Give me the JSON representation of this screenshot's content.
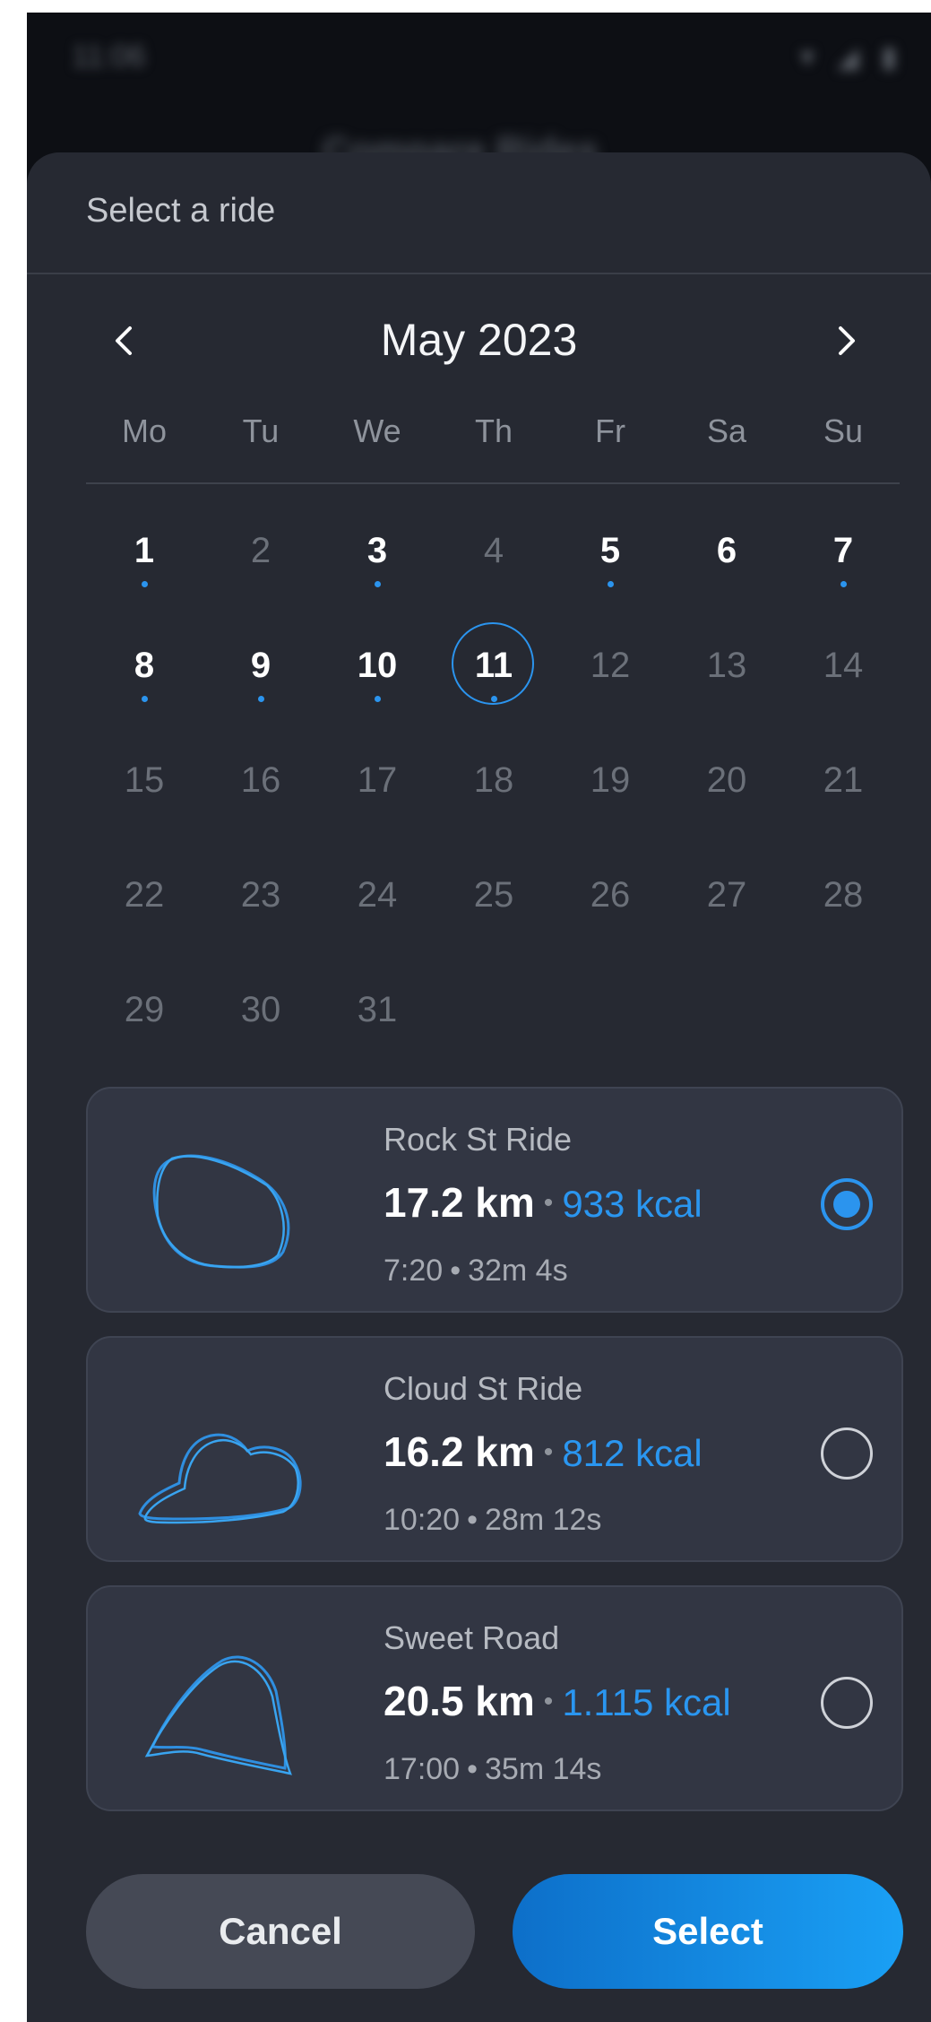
{
  "status_bar": {
    "time": "11:06",
    "icons": "▾ ◢ ▮"
  },
  "background": {
    "title": "Compare Rides"
  },
  "sheet": {
    "title": "Select a ride",
    "month": "May 2023",
    "weekdays": [
      "Mo",
      "Tu",
      "We",
      "Th",
      "Fr",
      "Sa",
      "Su"
    ],
    "days": [
      {
        "n": "1",
        "active": true,
        "dot": true
      },
      {
        "n": "2",
        "active": false,
        "dot": false
      },
      {
        "n": "3",
        "active": true,
        "dot": true
      },
      {
        "n": "4",
        "active": false,
        "dot": false
      },
      {
        "n": "5",
        "active": true,
        "dot": true
      },
      {
        "n": "6",
        "active": true,
        "dot": false
      },
      {
        "n": "7",
        "active": true,
        "dot": true
      },
      {
        "n": "8",
        "active": true,
        "dot": true
      },
      {
        "n": "9",
        "active": true,
        "dot": true
      },
      {
        "n": "10",
        "active": true,
        "dot": true
      },
      {
        "n": "11",
        "active": true,
        "dot": true,
        "selected": true
      },
      {
        "n": "12",
        "active": false,
        "dot": false
      },
      {
        "n": "13",
        "active": false,
        "dot": false
      },
      {
        "n": "14",
        "active": false,
        "dot": false
      },
      {
        "n": "15",
        "active": false,
        "dot": false
      },
      {
        "n": "16",
        "active": false,
        "dot": false
      },
      {
        "n": "17",
        "active": false,
        "dot": false
      },
      {
        "n": "18",
        "active": false,
        "dot": false
      },
      {
        "n": "19",
        "active": false,
        "dot": false
      },
      {
        "n": "20",
        "active": false,
        "dot": false
      },
      {
        "n": "21",
        "active": false,
        "dot": false
      },
      {
        "n": "22",
        "active": false,
        "dot": false
      },
      {
        "n": "23",
        "active": false,
        "dot": false
      },
      {
        "n": "24",
        "active": false,
        "dot": false
      },
      {
        "n": "25",
        "active": false,
        "dot": false
      },
      {
        "n": "26",
        "active": false,
        "dot": false
      },
      {
        "n": "27",
        "active": false,
        "dot": false
      },
      {
        "n": "28",
        "active": false,
        "dot": false
      },
      {
        "n": "29",
        "active": false,
        "dot": false
      },
      {
        "n": "30",
        "active": false,
        "dot": false
      },
      {
        "n": "31",
        "active": false,
        "dot": false
      }
    ]
  },
  "rides": [
    {
      "name": "Rock St Ride",
      "distance": "17.2 km",
      "separator": "•",
      "kcal": "933 kcal",
      "time": "7:20",
      "duration": "32m 4s",
      "selected": true
    },
    {
      "name": "Cloud St Ride",
      "distance": "16.2 km",
      "separator": "•",
      "kcal": "812 kcal",
      "time": "10:20",
      "duration": "28m 12s",
      "selected": false
    },
    {
      "name": "Sweet Road",
      "distance": "20.5 km",
      "separator": "•",
      "kcal": "1.115 kcal",
      "time": "17:00",
      "duration": "35m 14s",
      "selected": false
    }
  ],
  "buttons": {
    "cancel": "Cancel",
    "select": "Select"
  },
  "colors": {
    "accent": "#2b94ee",
    "sheet_bg": "#262932",
    "card_bg": "#323643"
  }
}
